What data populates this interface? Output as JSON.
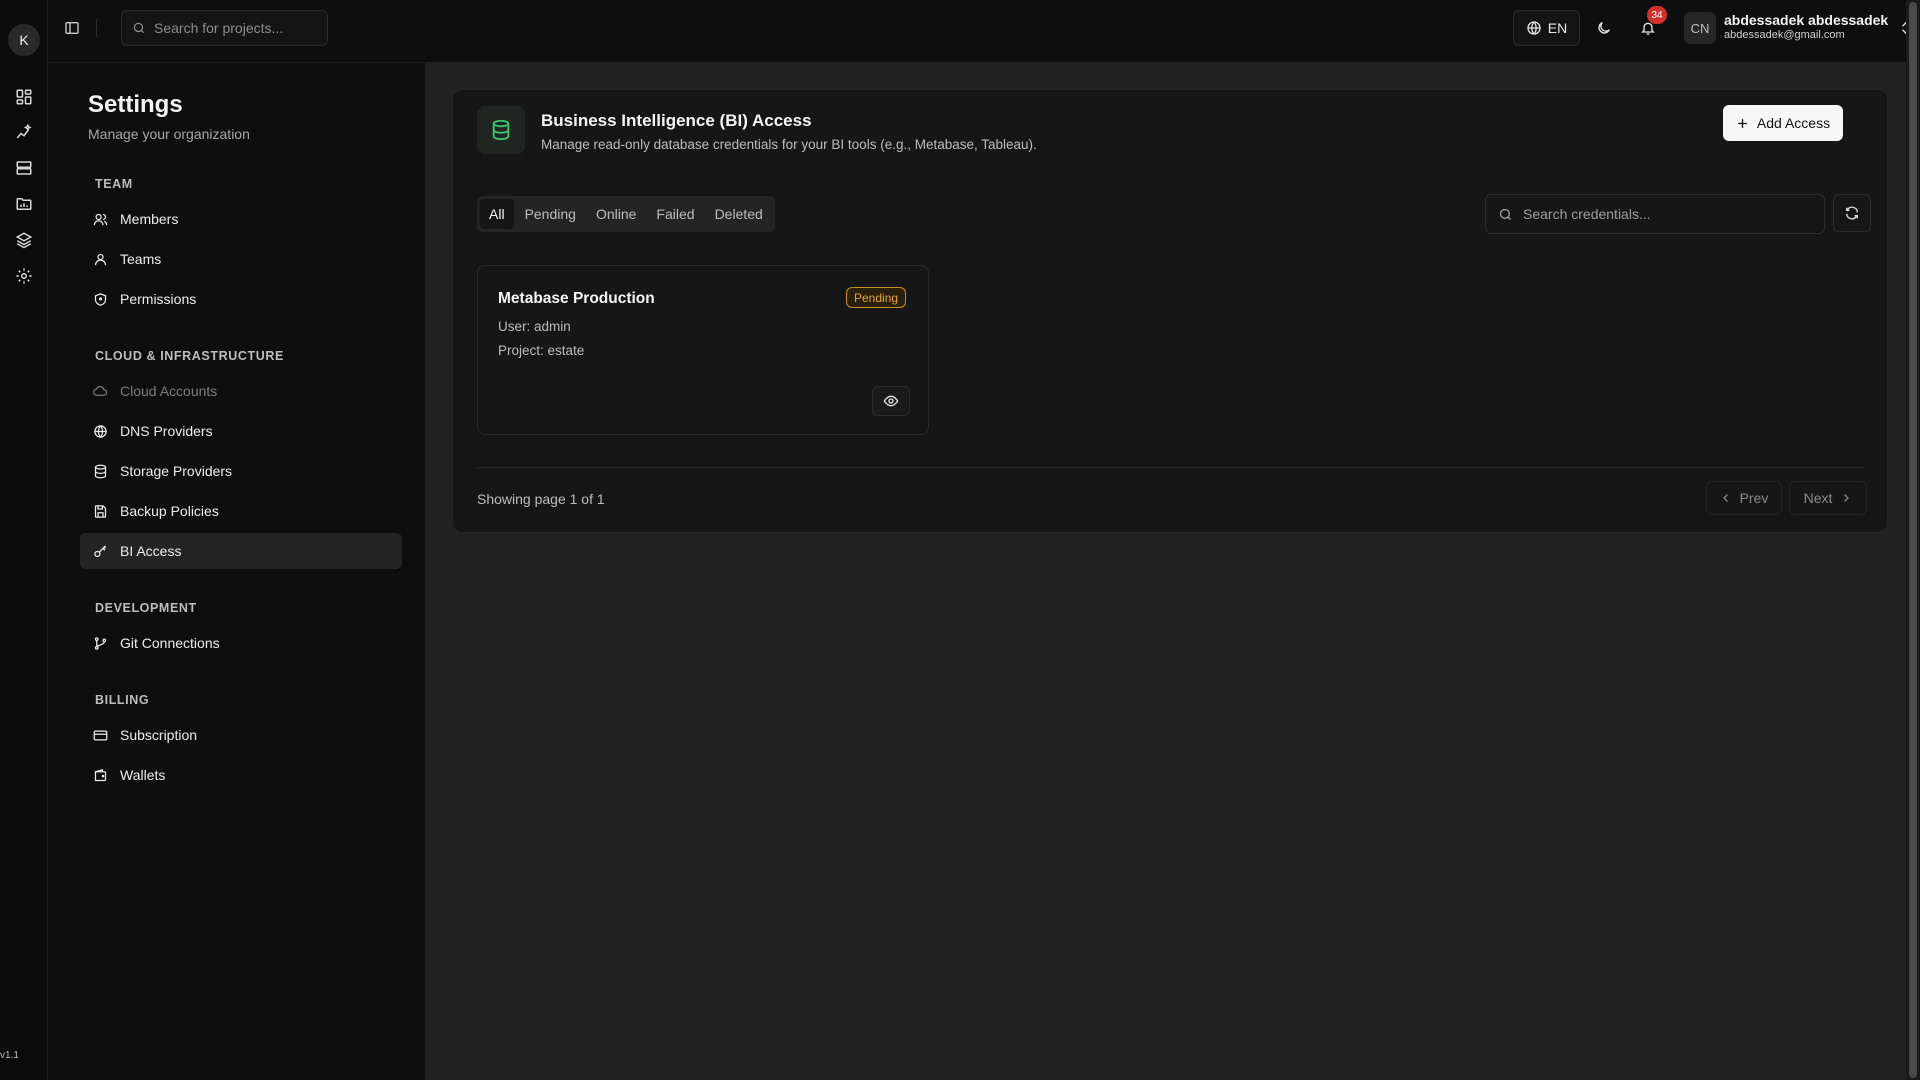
{
  "app": {
    "logo_letter": "K",
    "version": "v1.1"
  },
  "rail": {
    "items": [
      {
        "icon": "dashboard-icon"
      },
      {
        "icon": "sparkle-chart-icon"
      },
      {
        "icon": "server-icon"
      },
      {
        "icon": "folder-chart-icon"
      },
      {
        "icon": "layers-icon"
      },
      {
        "icon": "gear-icon"
      }
    ]
  },
  "topbar": {
    "search_placeholder": "Search for projects...",
    "language": "EN",
    "notification_count": "34",
    "user": {
      "initials": "CN",
      "name": "abdessadek abdessadek",
      "email": "abdessadek@gmail.com"
    }
  },
  "settings": {
    "title": "Settings",
    "subtitle": "Manage your organization",
    "sections": {
      "team": "TEAM",
      "cloud": "CLOUD & INFRASTRUCTURE",
      "development": "DEVELOPMENT",
      "billing": "BILLING"
    },
    "items": {
      "members": "Members",
      "teams": "Teams",
      "permissions": "Permissions",
      "cloud_accounts": "Cloud Accounts",
      "dns_providers": "DNS Providers",
      "storage_providers": "Storage Providers",
      "backup_policies": "Backup Policies",
      "bi_access": "BI Access",
      "git_connections": "Git Connections",
      "subscription": "Subscription",
      "wallets": "Wallets"
    },
    "active_item": "BI Access"
  },
  "main": {
    "title": "Business Intelligence (BI) Access",
    "description": "Manage read-only database credentials for your BI tools (e.g., Metabase, Tableau).",
    "add_button": "Add Access",
    "tabs": [
      "All",
      "Pending",
      "Online",
      "Failed",
      "Deleted"
    ],
    "active_tab": "All",
    "search_placeholder": "Search credentials...",
    "credentials": [
      {
        "name": "Metabase Production",
        "user": "User: admin",
        "project": "Project: estate",
        "status": "Pending"
      }
    ],
    "pagination": {
      "info": "Showing page 1 of 1",
      "prev": "Prev",
      "next": "Next"
    }
  },
  "colors": {
    "accent_green": "#3ec46d",
    "pending_amber": "#e0a63a",
    "badge_red": "#d0312d"
  }
}
